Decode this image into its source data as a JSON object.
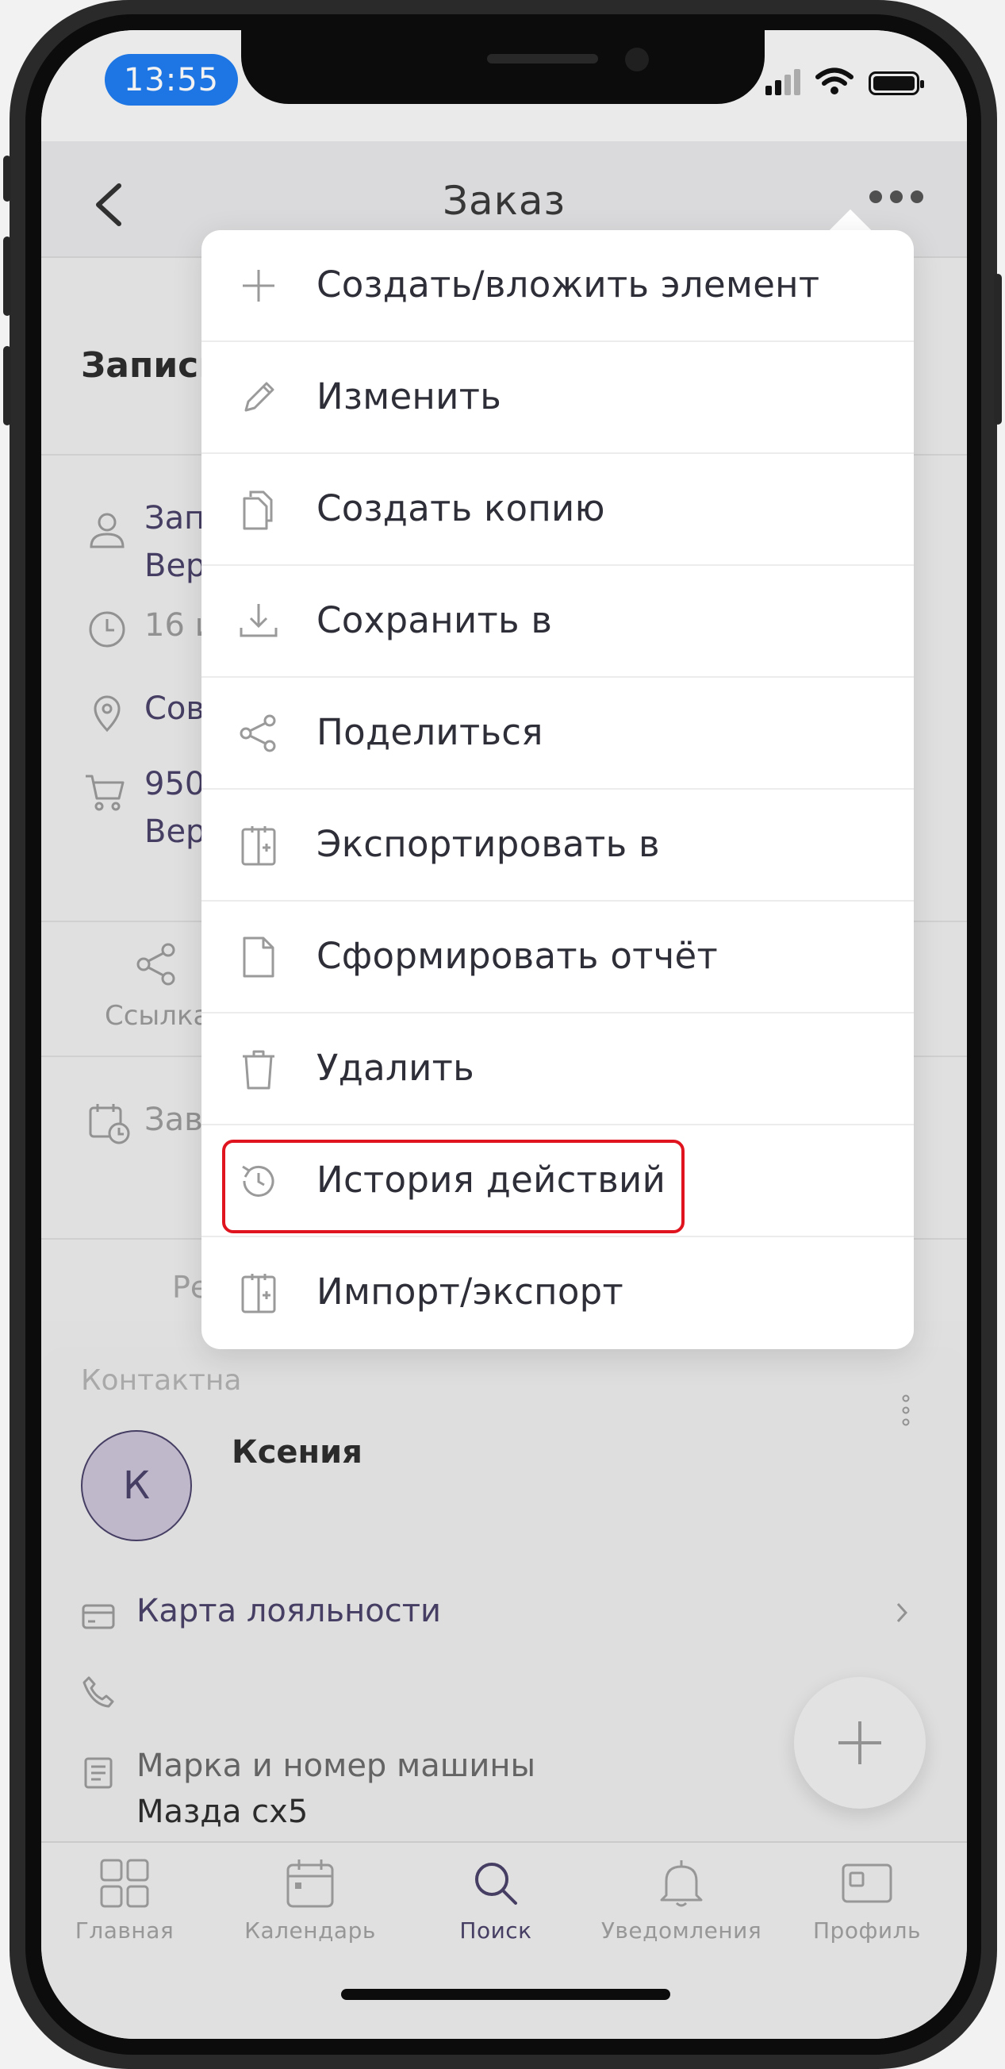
{
  "status_bar": {
    "time": "13:55"
  },
  "header": {
    "title": "Заказ"
  },
  "record": {
    "title": "Запись М",
    "client_line1": "Записа",
    "client_line2": "Верхн",
    "datetime": "16 ию",
    "address": "Совето",
    "price_line1": "950 ₽ :",
    "price_line2": "Верхн",
    "link_label": "Ссылка",
    "status": "Завер",
    "region_label": "Реги"
  },
  "contact": {
    "section_label": "Контактна",
    "avatar_letter": "К",
    "name": "Ксения",
    "loyalty_card": "Карта лояльности",
    "car_label": "Марка и номер машины",
    "car_value": "Мазда cx5"
  },
  "menu": {
    "items": [
      {
        "label": "Создать/вложить элемент",
        "icon": "plus-icon"
      },
      {
        "label": "Изменить",
        "icon": "pencil-icon"
      },
      {
        "label": "Создать копию",
        "icon": "copy-icon"
      },
      {
        "label": "Сохранить в",
        "icon": "download-icon"
      },
      {
        "label": "Поделиться",
        "icon": "share-icon"
      },
      {
        "label": "Экспортировать в",
        "icon": "export-icon"
      },
      {
        "label": "Сформировать отчёт",
        "icon": "document-icon"
      },
      {
        "label": "Удалить",
        "icon": "trash-icon"
      },
      {
        "label": "История действий",
        "icon": "history-icon"
      },
      {
        "label": "Импорт/экспорт",
        "icon": "import-export-icon"
      }
    ]
  },
  "tabs": [
    {
      "label": "Главная",
      "icon": "grid-icon"
    },
    {
      "label": "Календарь",
      "icon": "calendar-icon"
    },
    {
      "label": "Поиск",
      "icon": "search-icon",
      "active": true
    },
    {
      "label": "Уведомления",
      "icon": "bell-icon"
    },
    {
      "label": "Профиль",
      "icon": "profile-icon"
    }
  ],
  "colors": {
    "accent": "#4a4269",
    "highlight": "#e0141f",
    "time_pill": "#1f7df0"
  }
}
